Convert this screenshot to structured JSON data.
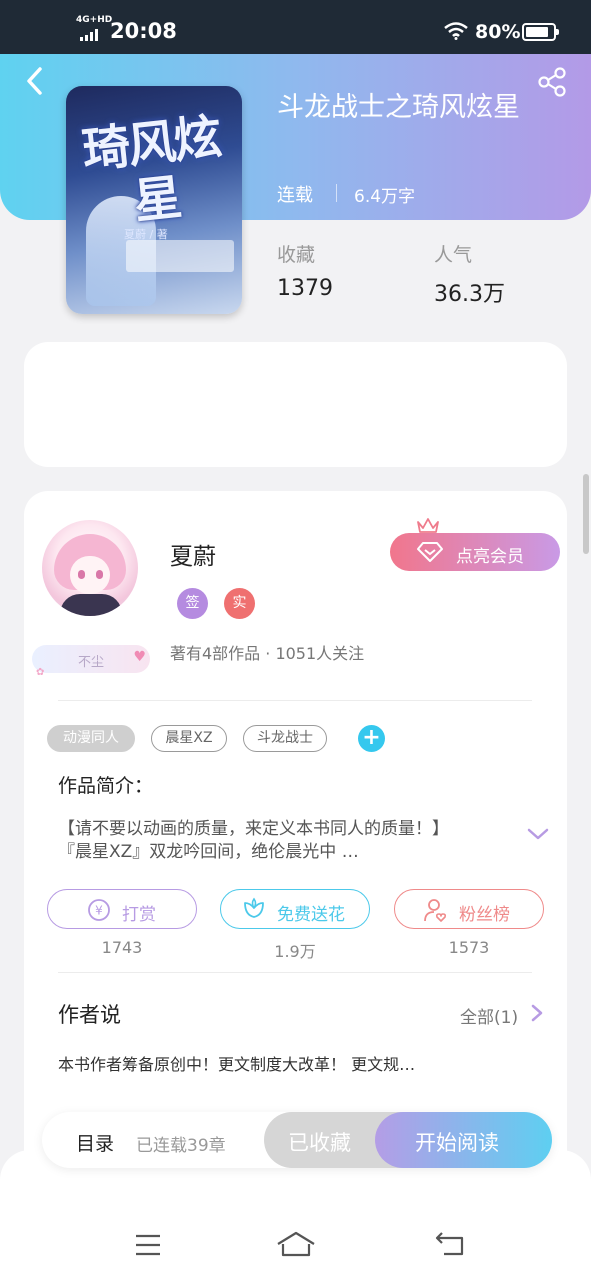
{
  "status_bar": {
    "network": "4G+HD",
    "time": "20:08",
    "battery": "80%"
  },
  "book": {
    "title": "斗龙战士之琦风炫星",
    "status": "连载",
    "word_count": "6.4万字",
    "cover_title": "琦风炫星",
    "cover_author": "夏蔚 / 著",
    "stats": [
      {
        "label": "收藏",
        "value": "1379"
      },
      {
        "label": "人气",
        "value": "36.3万"
      }
    ]
  },
  "author": {
    "name": "夏蔚",
    "badges": [
      "签",
      "实"
    ],
    "meta": "著有4部作品 · 1051人关注",
    "fan_badge": "不尘",
    "vip_button": "点亮会员"
  },
  "tags": [
    "动漫同人",
    "晨星XZ",
    "斗龙战士"
  ],
  "intro": {
    "title": "作品简介：",
    "lines": [
      "【请不要以动画的质量，来定义本书同人的质量！】",
      "『晨星XZ』双龙吟回间，绝伦晨光中 …"
    ]
  },
  "actions": [
    {
      "label": "打赏",
      "count": "1743",
      "color": "#b79be3"
    },
    {
      "label": "免费送花",
      "count": "1.9万",
      "color": "#4cc9ea"
    },
    {
      "label": "粉丝榜",
      "count": "1573",
      "color": "#ef8a8a"
    }
  ],
  "author_says": {
    "title": "作者说",
    "all_link": "全部(1)",
    "note": "本书作者筹备原创中！更文制度大改革！ 更文规…"
  },
  "bottom_bar": {
    "toc": "目录",
    "toc_sub": "已连载39章",
    "collected": "已收藏",
    "read": "开始阅读"
  },
  "colors": {
    "accent_blue": "#5ecff1",
    "accent_purple": "#b49de6",
    "badge_sign": "#b58be0",
    "badge_real": "#ef7070"
  }
}
